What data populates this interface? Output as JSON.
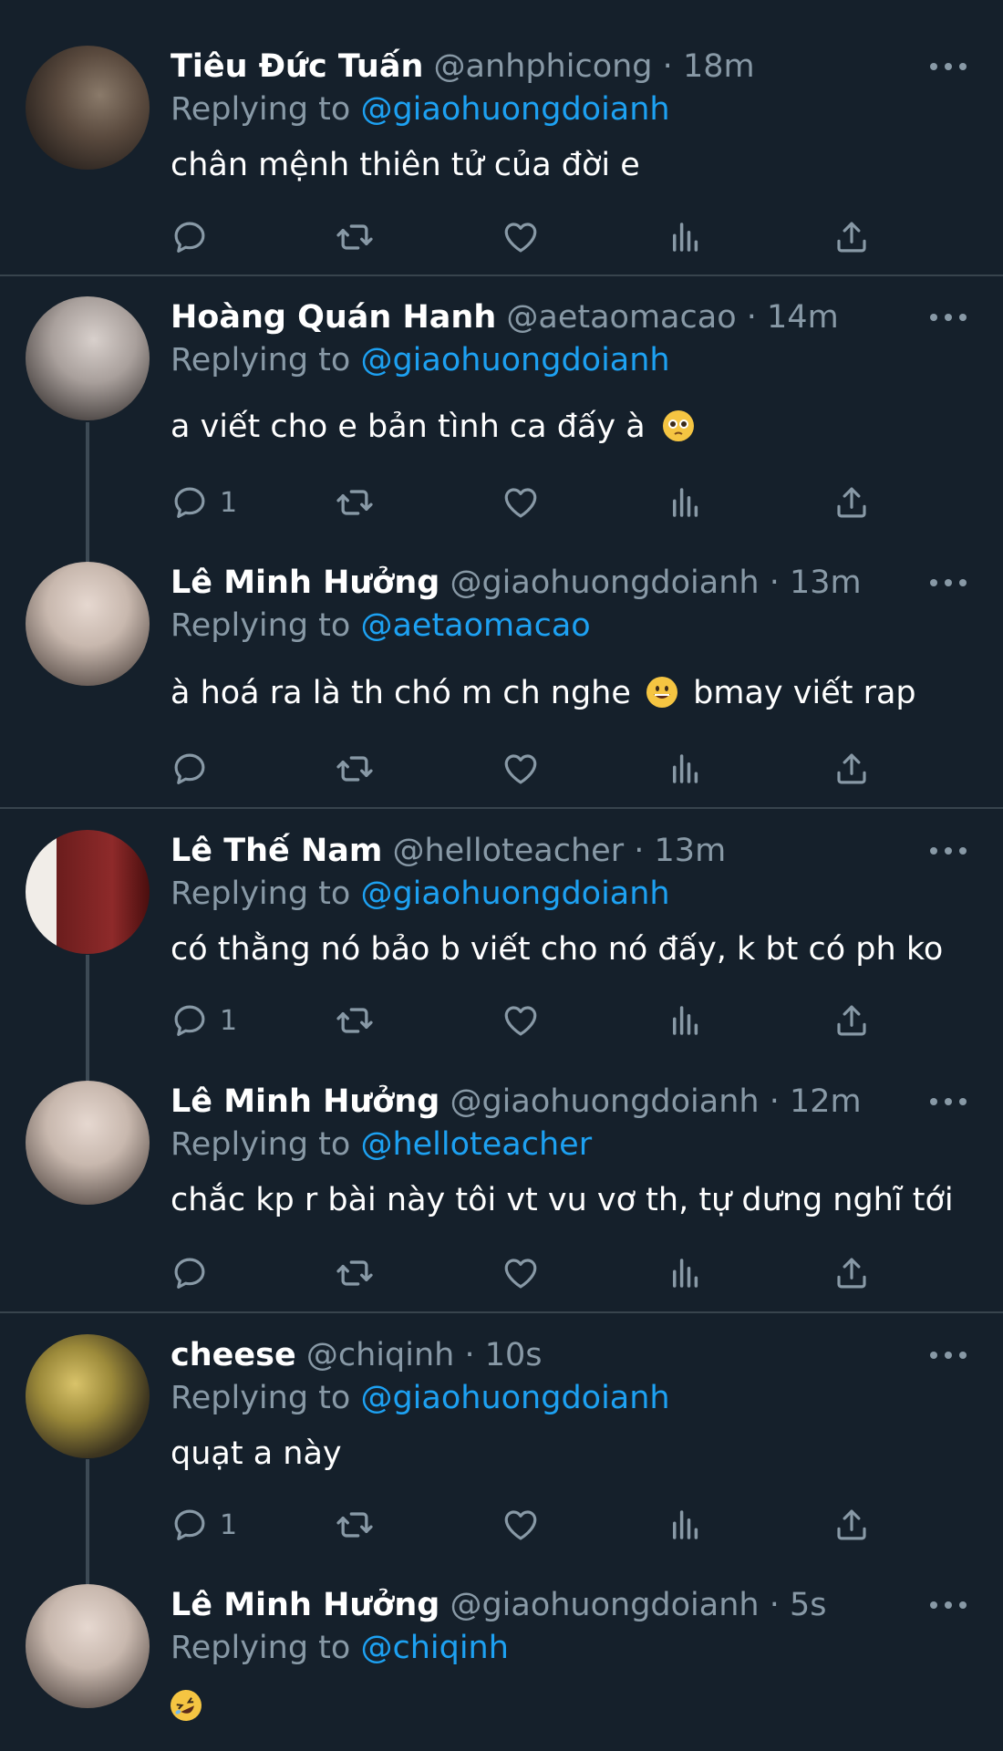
{
  "tweets": [
    {
      "name": "Tiêu Đức Tuấn",
      "handle": "@anhphicong",
      "sep": "·",
      "time": "18m",
      "reply_prefix": "Replying to",
      "reply_to": "@giaohuongdoianh",
      "text": "chân mệnh thiên tử của đời e",
      "reply_count": ""
    },
    {
      "name": "Hoàng Quán Hanh",
      "handle": "@aetaomacao",
      "sep": "·",
      "time": "14m",
      "reply_prefix": "Replying to",
      "reply_to": "@giaohuongdoianh",
      "text": "a viết cho e bản tình ca đấy à",
      "reply_count": "1"
    },
    {
      "name": "Lê Minh Hưởng",
      "handle": "@giaohuongdoianh",
      "sep": "·",
      "time": "13m",
      "reply_prefix": "Replying to",
      "reply_to": "@aetaomacao",
      "text_a": "à hoá ra là th chó m ch nghe",
      "text_b": "bmay viết rap",
      "reply_count": ""
    },
    {
      "name": "Lê Thế Nam",
      "handle": "@helloteacher",
      "sep": "·",
      "time": "13m",
      "reply_prefix": "Replying to",
      "reply_to": "@giaohuongdoianh",
      "text": "có thằng nó bảo b viết cho nó đấy, k bt có ph ko",
      "reply_count": "1"
    },
    {
      "name": "Lê Minh Hưởng",
      "handle": "@giaohuongdoianh",
      "sep": "·",
      "time": "12m",
      "reply_prefix": "Replying to",
      "reply_to": "@helloteacher",
      "text": "chắc kp r bài này tôi vt vu vơ th, tự dưng nghĩ tới",
      "reply_count": ""
    },
    {
      "name": "cheese",
      "handle": "@chiqinh",
      "sep": "·",
      "time": "10s",
      "reply_prefix": "Replying to",
      "reply_to": "@giaohuongdoianh",
      "text": "quạt a này",
      "reply_count": "1"
    },
    {
      "name": "Lê Minh Hưởng",
      "handle": "@giaohuongdoianh",
      "sep": "·",
      "time": "5s",
      "reply_prefix": "Replying to",
      "reply_to": "@chiqinh",
      "text": "",
      "reply_count": ""
    }
  ],
  "icons": {
    "reply": "reply-icon",
    "retweet": "retweet-icon",
    "like": "heart-icon",
    "analytics": "analytics-icon",
    "share": "share-icon",
    "more": "more-icon"
  },
  "colors": {
    "background": "#15202b",
    "divider": "#38444d",
    "secondary_text": "#8899a6",
    "link": "#1da1f2"
  }
}
